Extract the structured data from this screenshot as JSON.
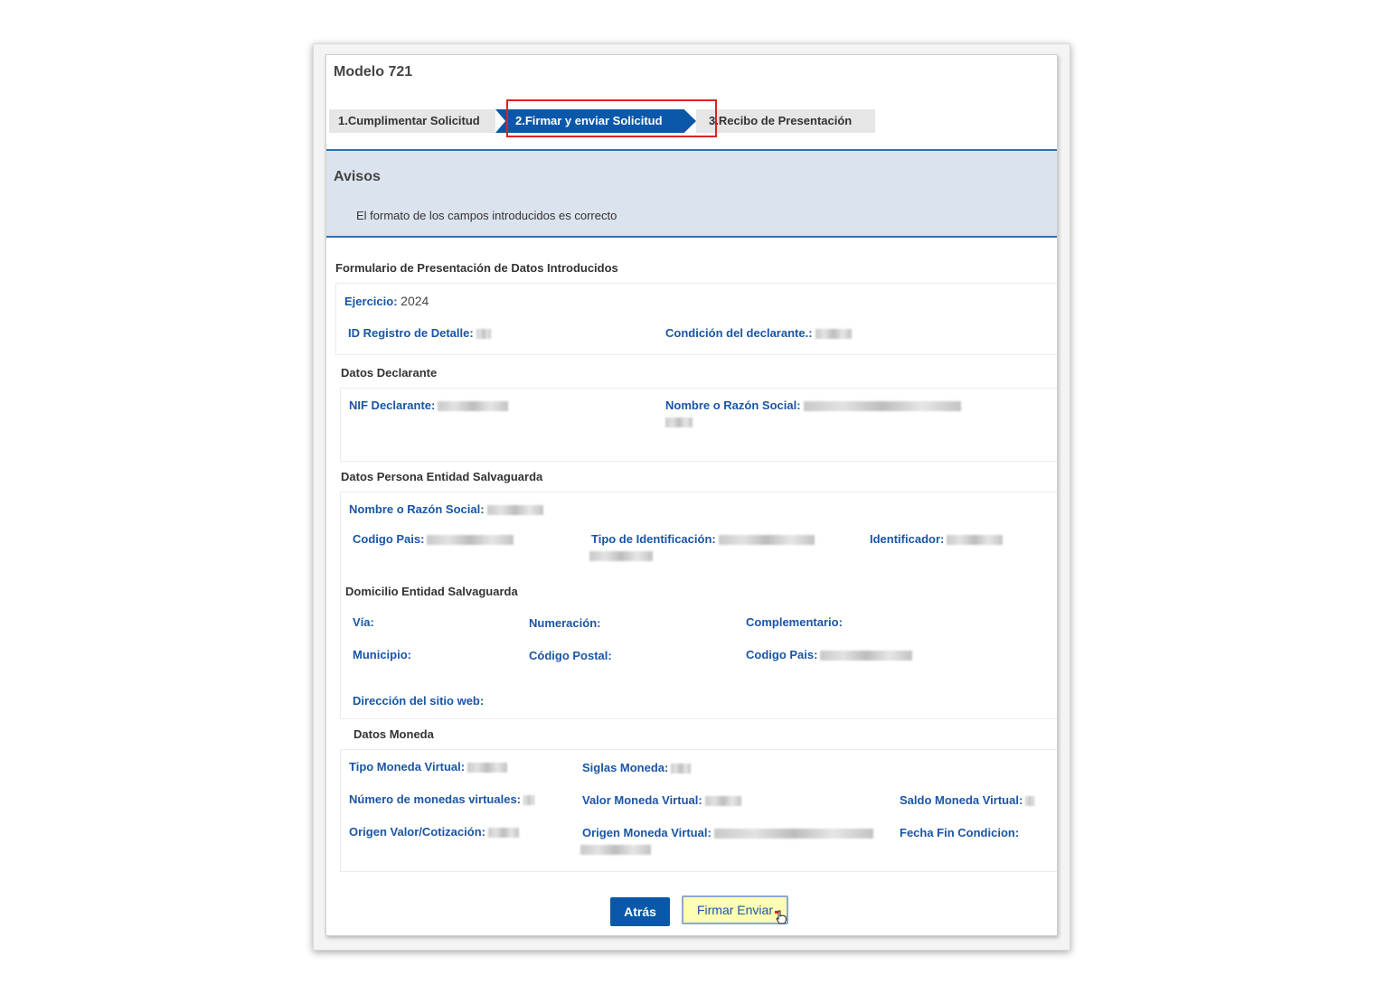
{
  "title": "Modelo 721",
  "steps": [
    {
      "label": "1.Cumplimentar Solicitud"
    },
    {
      "label": "2.Firmar y enviar Solicitud"
    },
    {
      "label": "3.Recibo de Presentación"
    }
  ],
  "avisos": {
    "title": "Avisos",
    "message": "El formato de los campos introducidos es correcto"
  },
  "form": {
    "heading": "Formulario de Presentación de Datos Introducidos",
    "ejercicio_label": "Ejercicio:",
    "ejercicio_value": "2024",
    "id_registro_label": "ID Registro de Detalle:",
    "condicion_label": "Condición del declarante.:",
    "datos_declarante": {
      "heading": "Datos Declarante",
      "nif_label": "NIF Declarante:",
      "nombre_label": "Nombre o Razón Social:"
    },
    "datos_persona": {
      "heading": "Datos Persona Entidad Salvaguarda",
      "nombre_label": "Nombre o Razón Social:",
      "codigo_pais_label": "Codigo Pais:",
      "tipo_id_label": "Tipo de Identificación:",
      "identificador_label": "Identificador:"
    },
    "domicilio": {
      "heading": "Domicilio Entidad Salvaguarda",
      "via_label": "Vía:",
      "numeracion_label": "Numeración:",
      "complementario_label": "Complementario:",
      "municipio_label": "Municipio:",
      "codigo_postal_label": "Código Postal:",
      "codigo_pais_label": "Codigo Pais:",
      "web_label": "Dirección del sitio web:"
    },
    "datos_moneda": {
      "heading": "Datos Moneda",
      "tipo_label": "Tipo Moneda Virtual:",
      "siglas_label": "Siglas Moneda:",
      "numero_label": "Número de monedas virtuales:",
      "valor_label": "Valor Moneda Virtual:",
      "saldo_label": "Saldo Moneda Virtual:",
      "origen_valor_label": "Origen Valor/Cotización:",
      "origen_moneda_label": "Origen Moneda Virtual:",
      "fecha_fin_label": "Fecha Fin Condicion:"
    }
  },
  "buttons": {
    "back": "Atrás",
    "sign": "Firmar Enviar"
  },
  "colors": {
    "accent": "#0b58a8",
    "label_blue": "#1a55a6",
    "highlight": "#e02020",
    "sign_button_bg": "#ffffb3"
  }
}
